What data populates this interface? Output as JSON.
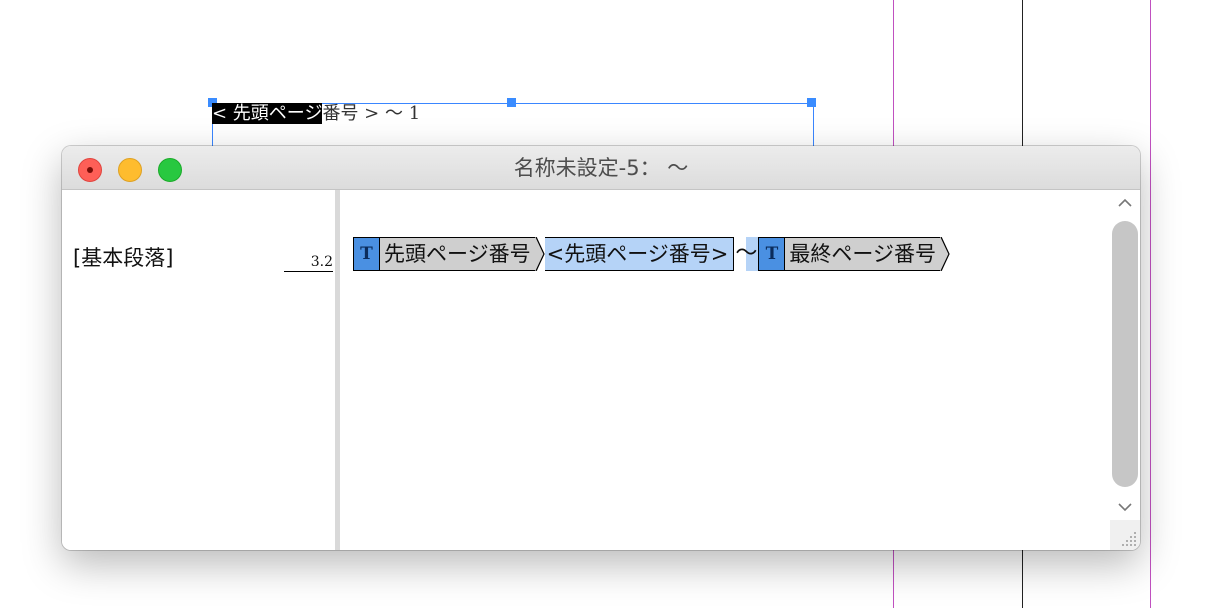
{
  "page": {
    "frame_text_selected": "< 先頭ページ",
    "frame_text_rest": "番号 > 〜 1"
  },
  "window": {
    "title": "名称未設定-5： 〜",
    "left_pane": {
      "paragraph_style": "[基本段落]",
      "depth": "3.2"
    },
    "story": {
      "var1_icon": "T",
      "var1_name": "先頭ページ番号",
      "var1_value": "<先頭ページ番号>",
      "separator": "〜",
      "var2_icon": "T",
      "var2_name": "最終ページ番号"
    },
    "scrollbar": {
      "up_icon": "chevron-up-icon",
      "down_icon": "chevron-down-icon"
    }
  },
  "colors": {
    "close": "#fe5f57",
    "minimize": "#febc2e",
    "zoom": "#28c840",
    "variable_tag": "#4a90e2",
    "variable_value_bg": "#b5d3f7",
    "selection_guide": "#3a86ff",
    "margin_guide": "#c050c0"
  }
}
